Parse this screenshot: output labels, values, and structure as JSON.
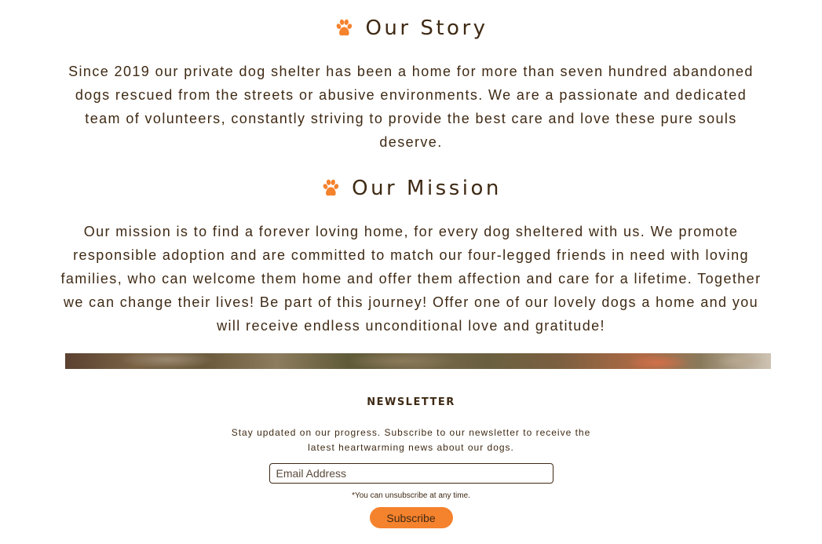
{
  "story": {
    "title": "Our Story",
    "icon": "paw-icon",
    "text": "Since 2019 our private dog shelter has been a home for more than seven hundred abandoned dogs rescued from the streets or abusive environments. We are a passionate and dedicated team of volunteers, constantly striving to provide the best care and love these pure souls deserve."
  },
  "mission": {
    "title": "Our Mission",
    "icon": "paw-icon",
    "text": "Our mission is to find a forever loving home, for every dog sheltered with us. We promote responsible adoption and are committed to match our four-legged friends in need with loving families, who can welcome them home and offer them affection and care for a lifetime. Together we can change their lives! Be part of this journey! Offer one of our lovely dogs a home and you will receive endless unconditional love and gratitude!"
  },
  "newsletter": {
    "title": "NEWSLETTER",
    "description": "Stay updated on our progress. Subscribe to our newsletter to receive the latest heartwarming news about our dogs.",
    "email_placeholder": "Email Address",
    "email_value": "",
    "note": "*You can unsubscribe at any time.",
    "button_label": "Subscribe"
  },
  "colors": {
    "text": "#3f2a14",
    "accent": "#f5822d",
    "background": "#ffffff"
  }
}
